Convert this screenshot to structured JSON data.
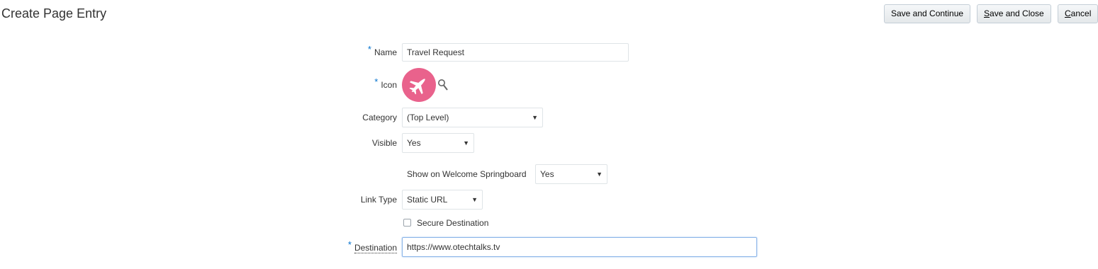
{
  "page": {
    "title": "Create Page Entry"
  },
  "toolbar": {
    "save_continue": "Save and Continue",
    "save_close_first": "S",
    "save_close_rest": "ave and Close",
    "cancel_first": "C",
    "cancel_rest": "ancel"
  },
  "form": {
    "required_marker": "*",
    "name": {
      "label": "Name",
      "value": "Travel Request"
    },
    "icon": {
      "label": "Icon",
      "icon_name": "airplane-icon",
      "color": "#e9628c"
    },
    "category": {
      "label": "Category",
      "value": "(Top Level)"
    },
    "visible": {
      "label": "Visible",
      "value": "Yes"
    },
    "springboard": {
      "label": "Show on Welcome Springboard",
      "value": "Yes"
    },
    "link_type": {
      "label": "Link Type",
      "value": "Static URL"
    },
    "secure": {
      "label": "Secure Destination",
      "checked": false
    },
    "destination": {
      "label": "Destination",
      "value": "https://www.otechtalks.tv"
    }
  },
  "colors": {
    "accent": "#0572ce",
    "icon_bg": "#e9628c"
  }
}
